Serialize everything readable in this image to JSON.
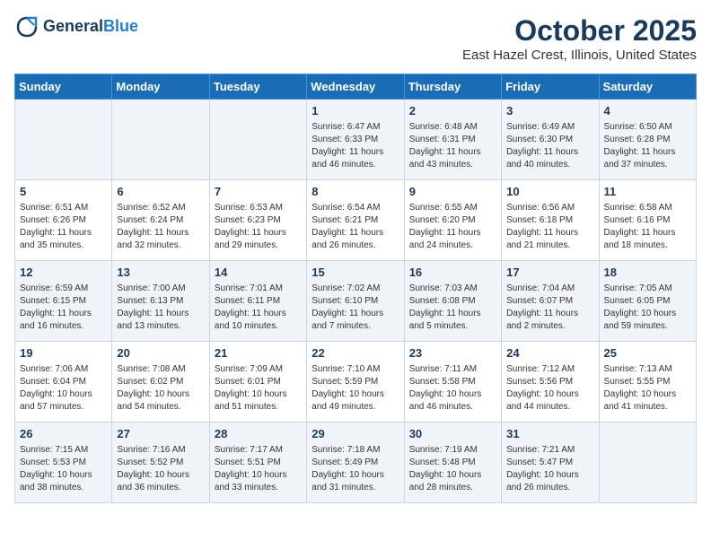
{
  "header": {
    "logo_line1": "General",
    "logo_line2": "Blue",
    "month": "October 2025",
    "location": "East Hazel Crest, Illinois, United States"
  },
  "days_of_week": [
    "Sunday",
    "Monday",
    "Tuesday",
    "Wednesday",
    "Thursday",
    "Friday",
    "Saturday"
  ],
  "weeks": [
    [
      {
        "day": "",
        "content": ""
      },
      {
        "day": "",
        "content": ""
      },
      {
        "day": "",
        "content": ""
      },
      {
        "day": "1",
        "content": "Sunrise: 6:47 AM\nSunset: 6:33 PM\nDaylight: 11 hours and 46 minutes."
      },
      {
        "day": "2",
        "content": "Sunrise: 6:48 AM\nSunset: 6:31 PM\nDaylight: 11 hours and 43 minutes."
      },
      {
        "day": "3",
        "content": "Sunrise: 6:49 AM\nSunset: 6:30 PM\nDaylight: 11 hours and 40 minutes."
      },
      {
        "day": "4",
        "content": "Sunrise: 6:50 AM\nSunset: 6:28 PM\nDaylight: 11 hours and 37 minutes."
      }
    ],
    [
      {
        "day": "5",
        "content": "Sunrise: 6:51 AM\nSunset: 6:26 PM\nDaylight: 11 hours and 35 minutes."
      },
      {
        "day": "6",
        "content": "Sunrise: 6:52 AM\nSunset: 6:24 PM\nDaylight: 11 hours and 32 minutes."
      },
      {
        "day": "7",
        "content": "Sunrise: 6:53 AM\nSunset: 6:23 PM\nDaylight: 11 hours and 29 minutes."
      },
      {
        "day": "8",
        "content": "Sunrise: 6:54 AM\nSunset: 6:21 PM\nDaylight: 11 hours and 26 minutes."
      },
      {
        "day": "9",
        "content": "Sunrise: 6:55 AM\nSunset: 6:20 PM\nDaylight: 11 hours and 24 minutes."
      },
      {
        "day": "10",
        "content": "Sunrise: 6:56 AM\nSunset: 6:18 PM\nDaylight: 11 hours and 21 minutes."
      },
      {
        "day": "11",
        "content": "Sunrise: 6:58 AM\nSunset: 6:16 PM\nDaylight: 11 hours and 18 minutes."
      }
    ],
    [
      {
        "day": "12",
        "content": "Sunrise: 6:59 AM\nSunset: 6:15 PM\nDaylight: 11 hours and 16 minutes."
      },
      {
        "day": "13",
        "content": "Sunrise: 7:00 AM\nSunset: 6:13 PM\nDaylight: 11 hours and 13 minutes."
      },
      {
        "day": "14",
        "content": "Sunrise: 7:01 AM\nSunset: 6:11 PM\nDaylight: 11 hours and 10 minutes."
      },
      {
        "day": "15",
        "content": "Sunrise: 7:02 AM\nSunset: 6:10 PM\nDaylight: 11 hours and 7 minutes."
      },
      {
        "day": "16",
        "content": "Sunrise: 7:03 AM\nSunset: 6:08 PM\nDaylight: 11 hours and 5 minutes."
      },
      {
        "day": "17",
        "content": "Sunrise: 7:04 AM\nSunset: 6:07 PM\nDaylight: 11 hours and 2 minutes."
      },
      {
        "day": "18",
        "content": "Sunrise: 7:05 AM\nSunset: 6:05 PM\nDaylight: 10 hours and 59 minutes."
      }
    ],
    [
      {
        "day": "19",
        "content": "Sunrise: 7:06 AM\nSunset: 6:04 PM\nDaylight: 10 hours and 57 minutes."
      },
      {
        "day": "20",
        "content": "Sunrise: 7:08 AM\nSunset: 6:02 PM\nDaylight: 10 hours and 54 minutes."
      },
      {
        "day": "21",
        "content": "Sunrise: 7:09 AM\nSunset: 6:01 PM\nDaylight: 10 hours and 51 minutes."
      },
      {
        "day": "22",
        "content": "Sunrise: 7:10 AM\nSunset: 5:59 PM\nDaylight: 10 hours and 49 minutes."
      },
      {
        "day": "23",
        "content": "Sunrise: 7:11 AM\nSunset: 5:58 PM\nDaylight: 10 hours and 46 minutes."
      },
      {
        "day": "24",
        "content": "Sunrise: 7:12 AM\nSunset: 5:56 PM\nDaylight: 10 hours and 44 minutes."
      },
      {
        "day": "25",
        "content": "Sunrise: 7:13 AM\nSunset: 5:55 PM\nDaylight: 10 hours and 41 minutes."
      }
    ],
    [
      {
        "day": "26",
        "content": "Sunrise: 7:15 AM\nSunset: 5:53 PM\nDaylight: 10 hours and 38 minutes."
      },
      {
        "day": "27",
        "content": "Sunrise: 7:16 AM\nSunset: 5:52 PM\nDaylight: 10 hours and 36 minutes."
      },
      {
        "day": "28",
        "content": "Sunrise: 7:17 AM\nSunset: 5:51 PM\nDaylight: 10 hours and 33 minutes."
      },
      {
        "day": "29",
        "content": "Sunrise: 7:18 AM\nSunset: 5:49 PM\nDaylight: 10 hours and 31 minutes."
      },
      {
        "day": "30",
        "content": "Sunrise: 7:19 AM\nSunset: 5:48 PM\nDaylight: 10 hours and 28 minutes."
      },
      {
        "day": "31",
        "content": "Sunrise: 7:21 AM\nSunset: 5:47 PM\nDaylight: 10 hours and 26 minutes."
      },
      {
        "day": "",
        "content": ""
      }
    ]
  ]
}
